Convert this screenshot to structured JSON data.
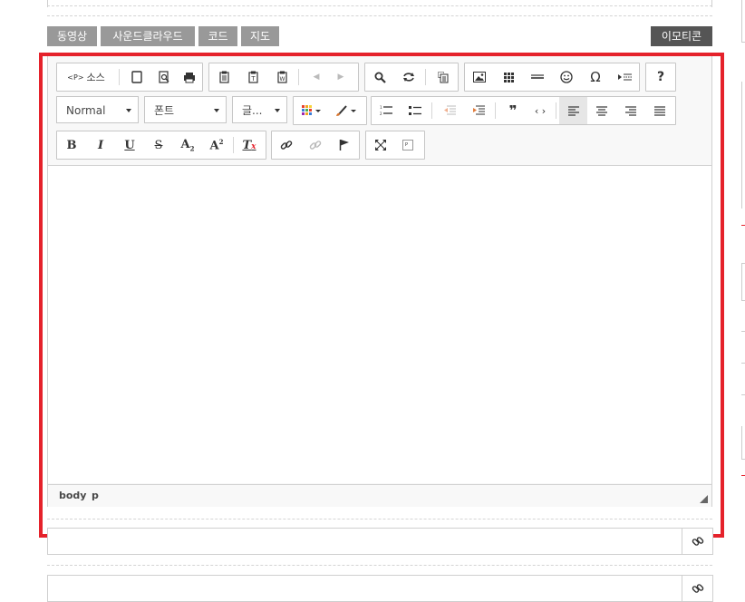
{
  "media_tabs": [
    "동영상",
    "사운드클라우드",
    "코드",
    "지도"
  ],
  "emoticon_label": "이모티콘",
  "toolbar": {
    "source_label": "소스",
    "format_value": "Normal",
    "font_value": "폰트",
    "size_value": "글...",
    "buttons": {
      "bold": "B",
      "italic": "I",
      "underline": "U",
      "strike": "S",
      "subscript": "A",
      "superscript": "A",
      "clear_format": "T",
      "help": "?",
      "omega": "Ω"
    }
  },
  "statusbar": {
    "path": [
      "body",
      "p"
    ]
  },
  "colors": {
    "accent_border": "#e5222b",
    "tab_bg": "#999999",
    "emoticon_bg": "#555555"
  }
}
